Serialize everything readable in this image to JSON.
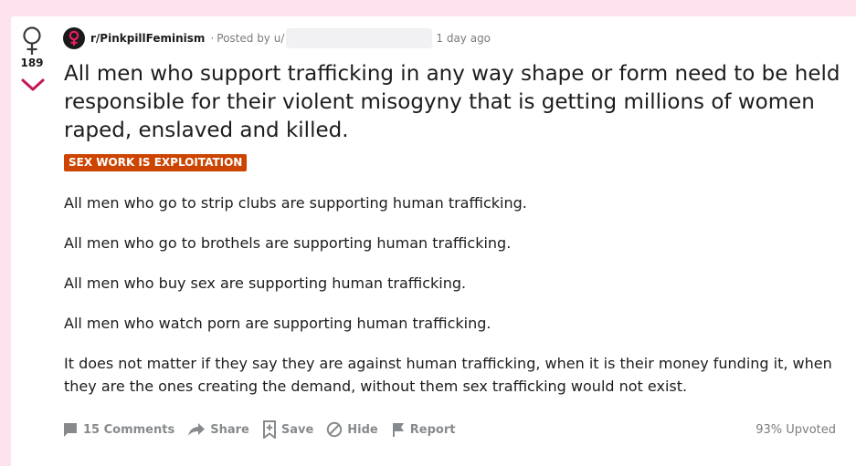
{
  "post": {
    "score": "189",
    "subreddit": "r/PinkpillFeminism",
    "posted_by_prefix": "Posted by u/",
    "separator": "·",
    "time": "1 day ago",
    "title": "All men who support trafficking in any way shape or form need to be held responsible for their violent misogyny that is getting millions of women raped, enslaved and killed.",
    "flair": "SEX WORK IS EXPLOITATION",
    "flair_color": "#cc4400",
    "body": [
      "All men who go to strip clubs are supporting human trafficking.",
      "All men who go to brothels are supporting human trafficking.",
      "All men who buy sex are supporting human trafficking.",
      "All men who watch porn are supporting human trafficking.",
      "It does not matter if they say they are against human trafficking, when it is their money funding it, when they are the ones creating the demand, without them sex trafficking would not exist."
    ]
  },
  "actions": {
    "comments": "15 Comments",
    "share": "Share",
    "save": "Save",
    "hide": "Hide",
    "report": "Report",
    "upvoted": "93% Upvoted"
  },
  "icons": {
    "upvote": "female-symbol-icon",
    "downvote": "chevron-down-icon",
    "subreddit": "female-symbol-icon",
    "comments": "comment-icon",
    "share": "share-arrow-icon",
    "save": "bookmark-icon",
    "hide": "hide-circle-icon",
    "report": "flag-icon"
  },
  "colors": {
    "page_background": "#fde3ee",
    "downvote": "#c2185b",
    "action_text": "#878a8c"
  }
}
